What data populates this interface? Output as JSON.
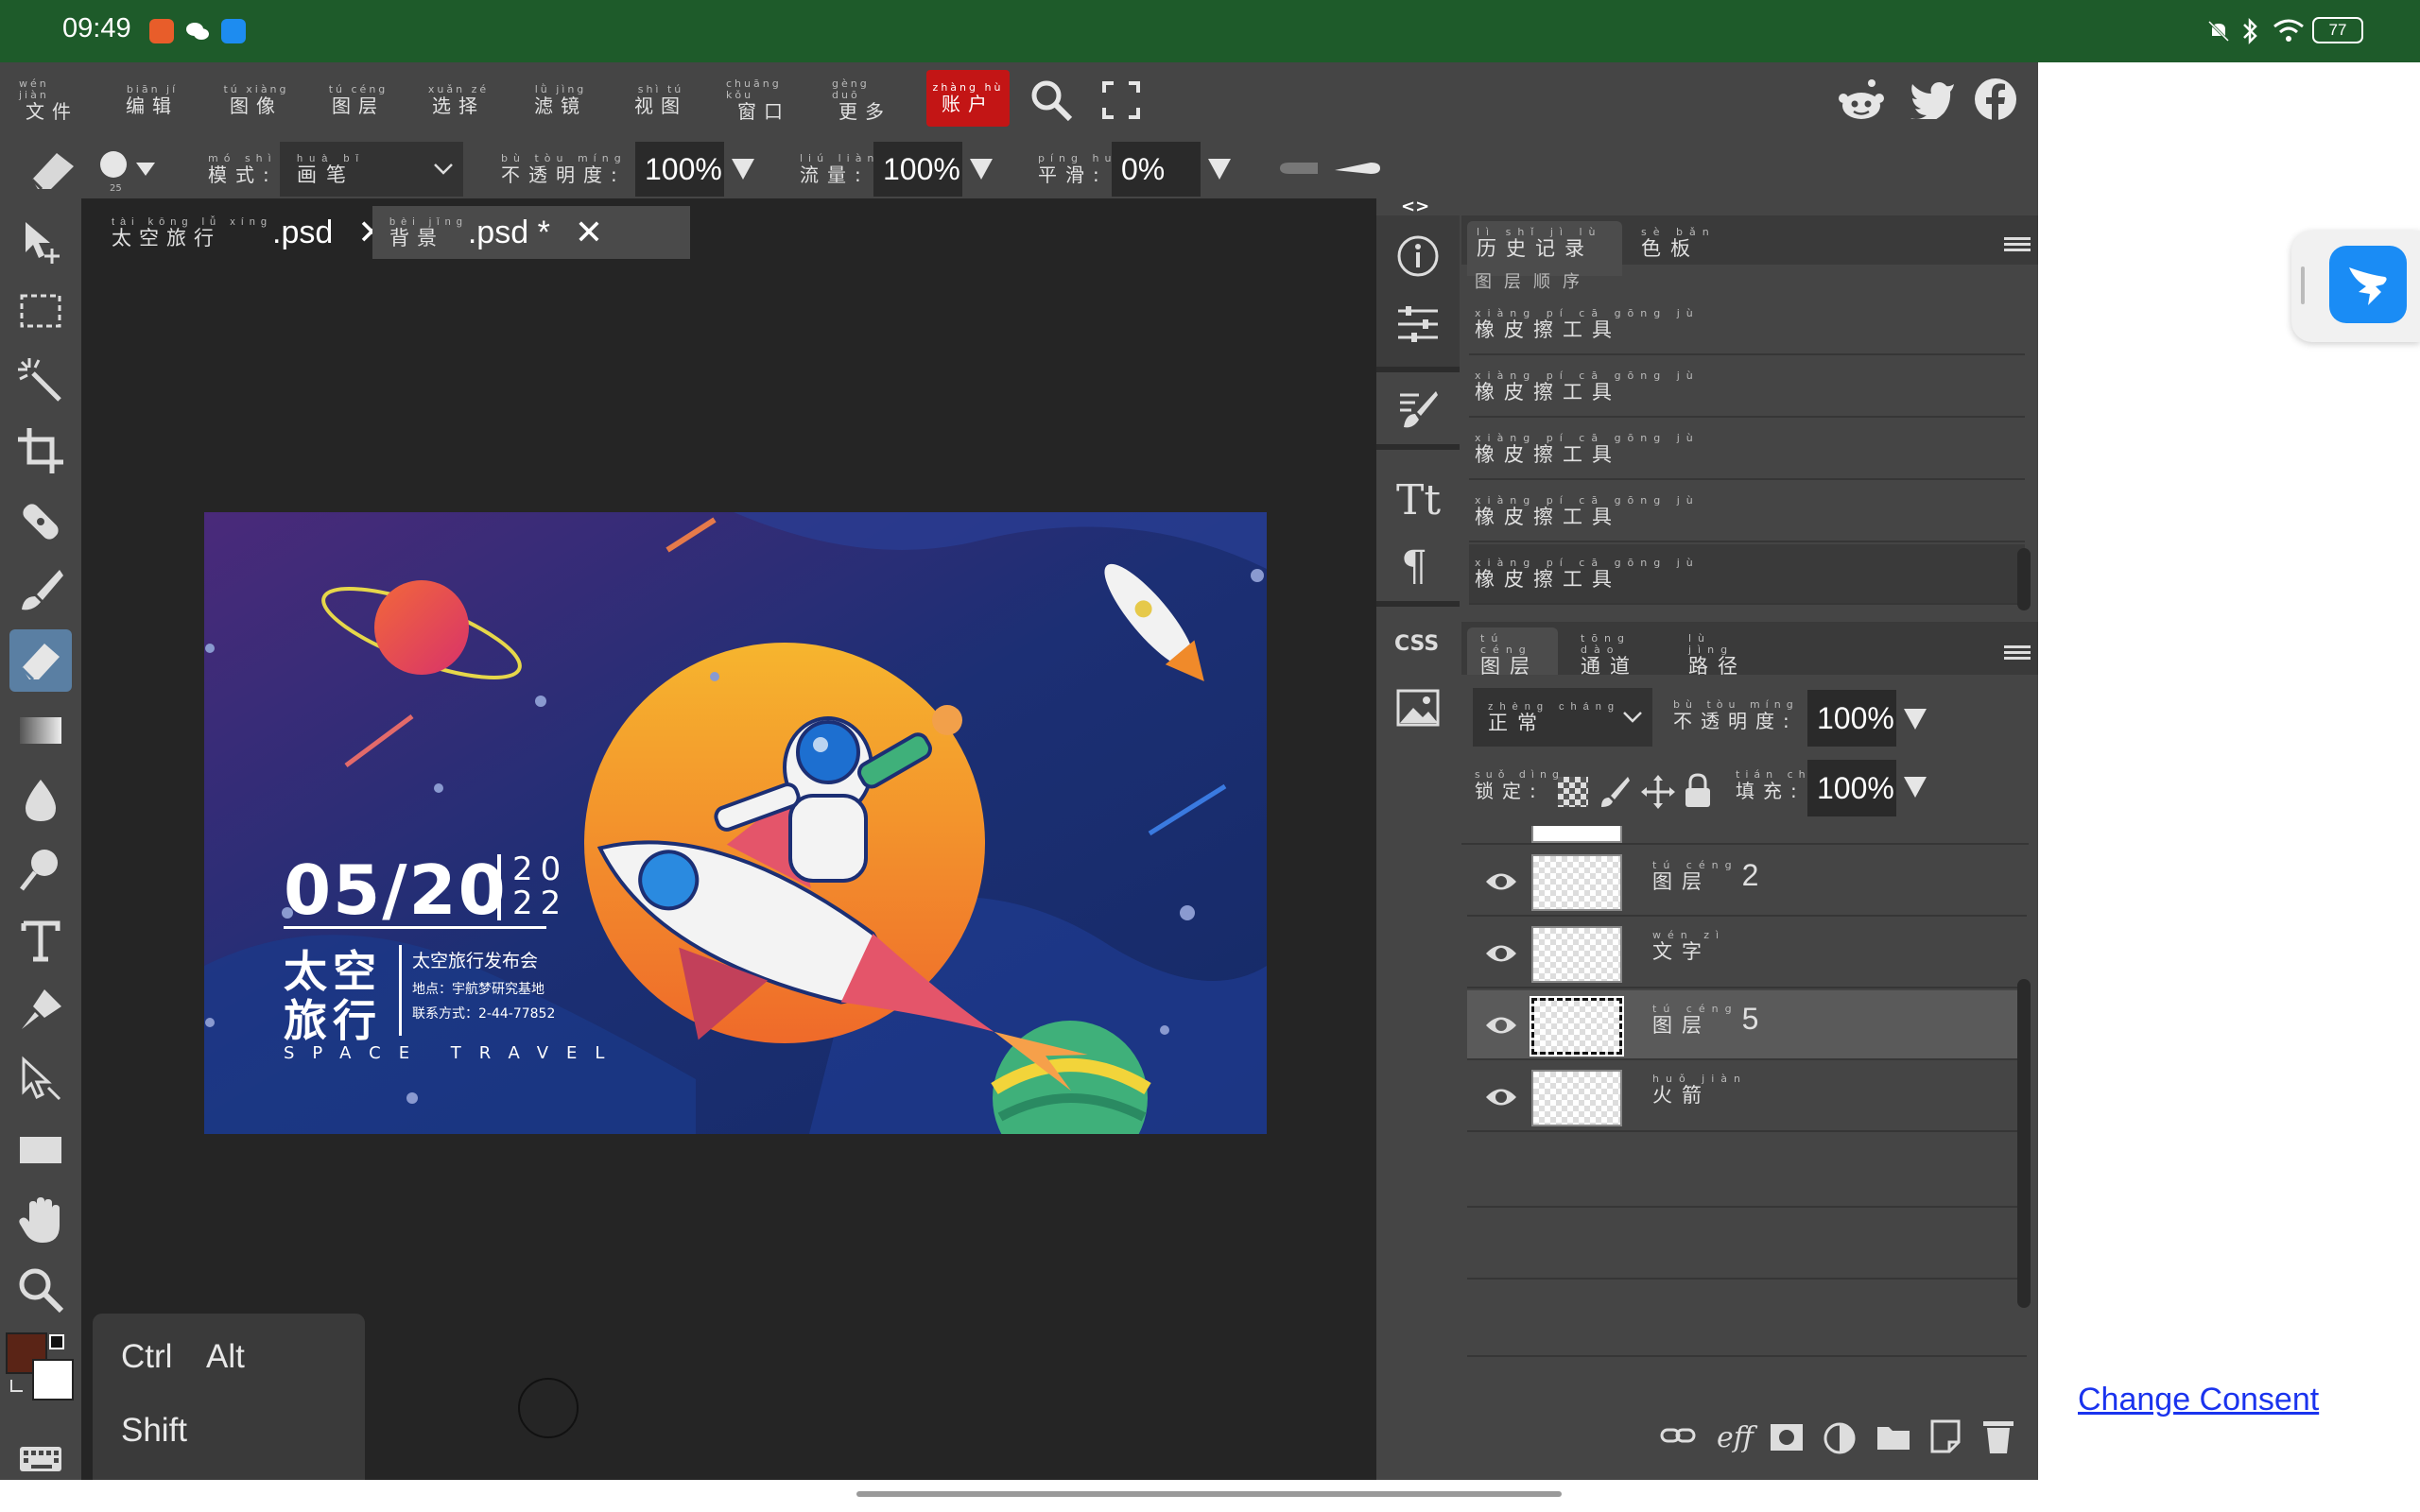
{
  "status": {
    "time": "09:49",
    "battery": "77"
  },
  "menu": [
    {
      "py": "wén jiàn",
      "hz": "文件"
    },
    {
      "py": "biān jí",
      "hz": "编辑"
    },
    {
      "py": "tú xiàng",
      "hz": "图像"
    },
    {
      "py": "tú céng",
      "hz": "图层"
    },
    {
      "py": "xuǎn zé",
      "hz": "选择"
    },
    {
      "py": "lǜ jìng",
      "hz": "滤镜"
    },
    {
      "py": "shì tú",
      "hz": "视图"
    },
    {
      "py": "chuāng kǒu",
      "hz": "窗口"
    },
    {
      "py": "gèng duō",
      "hz": "更多"
    },
    {
      "py": "zhàng hù",
      "hz": "账户"
    }
  ],
  "options": {
    "mode": {
      "py": "mó shì",
      "hz": "模式:",
      "value_py": "huà bǐ",
      "value": "画笔"
    },
    "opacity": {
      "py": "bù tòu míng dù",
      "hz": "不透明度:",
      "value": "100%"
    },
    "flow": {
      "py": "liú liàng",
      "hz": "流量:",
      "value": "100%"
    },
    "smooth": {
      "py": "píng huá",
      "hz": "平滑:",
      "value": "0%"
    },
    "brush_size": "25"
  },
  "tabs": [
    {
      "py": "tài kōng lǚ xíng",
      "hz": "太空旅行",
      "ext": ".psd",
      "close": "✕"
    },
    {
      "py": "bèi jǐng",
      "hz": "背景",
      "ext": ".psd *",
      "close": "✕"
    }
  ],
  "artwork": {
    "date": "05/20",
    "year_top": "20",
    "year_bottom": "22",
    "title1": "太空",
    "title2": "旅行",
    "event": "太空旅行发布会",
    "location": "地点：宇航梦研究基地",
    "contact": "联系方式：2-44-77852",
    "tagline": "SPACE TRAVEL"
  },
  "panel_arrows": {
    "left": "<>",
    "right": "><"
  },
  "history_panel": {
    "tabs": [
      {
        "py": "lì shǐ jì lù",
        "hz": "历史记录"
      },
      {
        "py": "sè bǎn",
        "hz": "色板"
      }
    ],
    "first_item": "图层顺序",
    "items": [
      {
        "py": "xiàng pí cā gōng jù",
        "hz": "橡皮擦工具"
      },
      {
        "py": "xiàng pí cā gōng jù",
        "hz": "橡皮擦工具"
      },
      {
        "py": "xiàng pí cā gōng jù",
        "hz": "橡皮擦工具"
      },
      {
        "py": "xiàng pí cā gōng jù",
        "hz": "橡皮擦工具"
      },
      {
        "py": "xiàng pí cā gōng jù",
        "hz": "橡皮擦工具"
      }
    ]
  },
  "layers_panel": {
    "tabs": [
      {
        "py": "tú céng",
        "hz": "图层"
      },
      {
        "py": "tōng dào",
        "hz": "通道"
      },
      {
        "py": "lù jìng",
        "hz": "路径"
      }
    ],
    "blend": {
      "py": "zhèng cháng",
      "hz": "正常"
    },
    "opacity": {
      "py": "bù tòu míng dù",
      "hz": "不透明度:",
      "value": "100%"
    },
    "lock": {
      "py": "suǒ dìng",
      "hz": "锁定:"
    },
    "fill": {
      "py": "tián chōng",
      "hz": "填充:",
      "value": "100%"
    },
    "layers": [
      {
        "py": "tú céng",
        "hz": "图层",
        "num": "2",
        "selected": false
      },
      {
        "py": "wén zì",
        "hz": "文字",
        "num": "",
        "selected": false
      },
      {
        "py": "tú céng",
        "hz": "图层",
        "num": "5",
        "selected": true
      },
      {
        "py": "huǒ jiàn",
        "hz": "火箭",
        "num": "",
        "selected": false
      }
    ],
    "footer_eff": "eff"
  },
  "keyboard": {
    "ctrl": "Ctrl",
    "alt": "Alt",
    "shift": "Shift"
  },
  "consent": "Change Consent",
  "colors": {
    "accent": "#c31515",
    "statusbar": "#1e5b2a",
    "panel": "#454545",
    "canvas_bg": "#252525",
    "foreground": "#5a2416",
    "background": "#ffffff"
  }
}
